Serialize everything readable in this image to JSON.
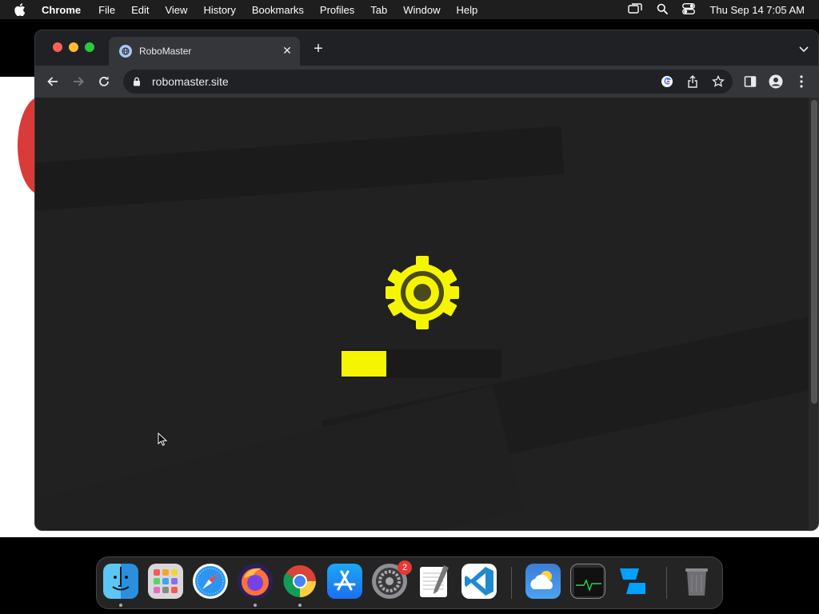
{
  "menubar": {
    "app_name": "Chrome",
    "menus": [
      "File",
      "Edit",
      "View",
      "History",
      "Bookmarks",
      "Profiles",
      "Tab",
      "Window",
      "Help"
    ],
    "clock": "Thu Sep 14  7:05 AM",
    "status_icons": [
      "screen-mirroring-icon",
      "spotlight-icon",
      "control-center-icon"
    ]
  },
  "browser": {
    "tab": {
      "title": "RoboMaster",
      "close_glyph": "✕"
    },
    "new_tab_glyph": "+",
    "address": "robomaster.site",
    "colors": {
      "frame": "#202124",
      "toolbar": "#35363a",
      "page_bg": "#212121"
    }
  },
  "page": {
    "loader": {
      "icon": "gear-icon",
      "icon_color": "#f5f500",
      "progress_fraction": 0.28,
      "progress_color": "#f5f500"
    }
  },
  "dock": {
    "apps": [
      {
        "name": "Finder",
        "icon": "finder-icon",
        "running": true
      },
      {
        "name": "Launchpad",
        "icon": "launchpad-icon",
        "running": false
      },
      {
        "name": "Safari",
        "icon": "safari-icon",
        "running": false
      },
      {
        "name": "Firefox",
        "icon": "firefox-icon",
        "running": true
      },
      {
        "name": "Chrome",
        "icon": "chrome-icon",
        "running": true
      },
      {
        "name": "App Store",
        "icon": "app-store-icon",
        "running": false
      },
      {
        "name": "System Settings",
        "icon": "system-settings-icon",
        "running": false,
        "badge": "2"
      },
      {
        "name": "TextEdit",
        "icon": "textedit-icon",
        "running": false
      },
      {
        "name": "Visual Studio Code",
        "icon": "vscode-icon",
        "running": false
      },
      {
        "name": "Weather",
        "icon": "weather-icon",
        "running": false
      },
      {
        "name": "Activity Monitor",
        "icon": "activity-monitor-icon",
        "running": false
      },
      {
        "name": "Roblox Studio",
        "icon": "roblox-studio-icon",
        "running": false
      },
      {
        "name": "Trash",
        "icon": "trash-icon",
        "running": false
      }
    ]
  }
}
